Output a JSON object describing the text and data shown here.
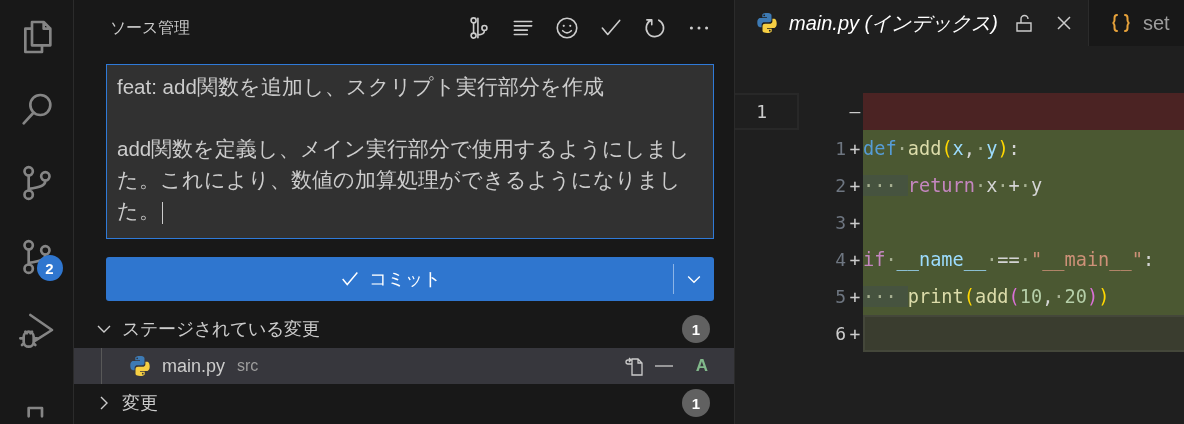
{
  "activity_bar": [
    {
      "kind": "files"
    },
    {
      "kind": "search"
    },
    {
      "kind": "source-control"
    },
    {
      "kind": "source-control",
      "badge": "2"
    },
    {
      "kind": "run-debug"
    },
    {
      "kind": "extension"
    }
  ],
  "sidebar": {
    "title": "ソース管理",
    "toolbar": [
      {
        "kind": "graph"
      },
      {
        "kind": "list"
      },
      {
        "kind": "smiley"
      },
      {
        "kind": "check"
      },
      {
        "kind": "refresh"
      },
      {
        "kind": "more"
      }
    ],
    "commit_message": "feat: add関数を追加し、スクリプト実行部分を作成\n\nadd関数を定義し、メイン実行部分で使用するようにしました。これにより、数値の加算処理ができるようになりました。",
    "commit_button": {
      "label": "コミット"
    },
    "sections": [
      {
        "label": "ステージされている変更",
        "expanded": true,
        "count": "1",
        "files": [
          {
            "name": "main.py",
            "folder": "src",
            "status": "A",
            "selected": true
          }
        ]
      },
      {
        "label": "変更",
        "expanded": false,
        "count": "1"
      }
    ]
  },
  "editor": {
    "tabs": [
      {
        "label": "main.py (インデックス)",
        "kind": "python",
        "selected": true,
        "locked": true
      },
      {
        "label": "set",
        "kind": "json",
        "selected": false
      }
    ],
    "diff_rows": [
      {
        "kind": "removed",
        "original_number": "1",
        "marker": "—",
        "current": false
      },
      {
        "kind": "added",
        "number": "1",
        "marker": "+",
        "current": false,
        "tokens": [
          {
            "text": "def",
            "kind": "keyword"
          },
          {
            "text": "·",
            "kind": "ws"
          },
          {
            "text": "add",
            "kind": "function"
          },
          {
            "text": "(",
            "kind": "bracket"
          },
          {
            "text": "x",
            "kind": "param"
          },
          {
            "text": ",",
            "kind": "plain"
          },
          {
            "text": "·",
            "kind": "ws"
          },
          {
            "text": "y",
            "kind": "param"
          },
          {
            "text": ")",
            "kind": "bracket"
          },
          {
            "text": ":",
            "kind": "plain"
          }
        ]
      },
      {
        "kind": "added",
        "number": "2",
        "marker": "+",
        "current": false,
        "tokens": [
          {
            "text": "···",
            "kind": "indent"
          },
          {
            "text": "return",
            "kind": "control"
          },
          {
            "text": "·",
            "kind": "ws"
          },
          {
            "text": "x",
            "kind": "plain"
          },
          {
            "text": "·",
            "kind": "ws"
          },
          {
            "text": "+",
            "kind": "plain"
          },
          {
            "text": "·",
            "kind": "ws"
          },
          {
            "text": "y",
            "kind": "plain"
          }
        ]
      },
      {
        "kind": "added",
        "number": "3",
        "marker": "+",
        "current": false
      },
      {
        "kind": "added",
        "number": "4",
        "marker": "+",
        "current": false,
        "tokens": [
          {
            "text": "if",
            "kind": "control"
          },
          {
            "text": "·",
            "kind": "ws"
          },
          {
            "text": "__name__",
            "kind": "param"
          },
          {
            "text": "·",
            "kind": "ws"
          },
          {
            "text": "==",
            "kind": "plain"
          },
          {
            "text": "·",
            "kind": "ws"
          },
          {
            "text": "\"__main__\"",
            "kind": "string"
          },
          {
            "text": ":",
            "kind": "plain"
          }
        ]
      },
      {
        "kind": "added",
        "number": "5",
        "marker": "+",
        "current": false,
        "tokens": [
          {
            "text": "···",
            "kind": "indent"
          },
          {
            "text": "print",
            "kind": "function"
          },
          {
            "text": "(",
            "kind": "bracket"
          },
          {
            "text": "add",
            "kind": "function"
          },
          {
            "text": "(",
            "kind": "bracket2"
          },
          {
            "text": "10",
            "kind": "number"
          },
          {
            "text": ",",
            "kind": "plain"
          },
          {
            "text": "·",
            "kind": "ws"
          },
          {
            "text": "20",
            "kind": "number"
          },
          {
            "text": ")",
            "kind": "bracket2"
          },
          {
            "text": ")",
            "kind": "bracket"
          }
        ]
      },
      {
        "kind": "added",
        "number": "6",
        "marker": "+",
        "current": true
      }
    ]
  }
}
